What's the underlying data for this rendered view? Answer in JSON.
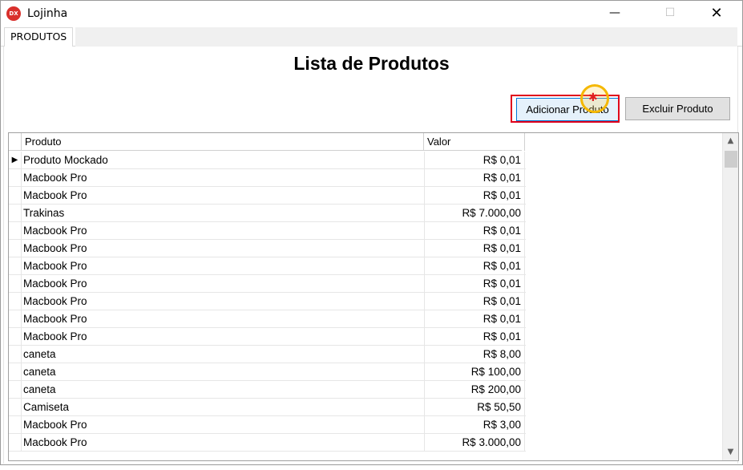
{
  "window": {
    "icon_text": "DX",
    "title": "Lojinha",
    "min_glyph": "—",
    "max_glyph": "☐",
    "close_glyph": "✕"
  },
  "tabs": [
    {
      "label": "PRODUTOS"
    }
  ],
  "main": {
    "heading": "Lista de Produtos",
    "add_button": "Adicionar Produto",
    "delete_button": "Excluir Produto"
  },
  "grid": {
    "columns": [
      "Produto",
      "Valor"
    ],
    "current_row_marker": "▶",
    "rows": [
      {
        "produto": "Produto Mockado",
        "valor": "R$ 0,01"
      },
      {
        "produto": "Macbook Pro",
        "valor": "R$ 0,01"
      },
      {
        "produto": "Macbook Pro",
        "valor": "R$ 0,01"
      },
      {
        "produto": "Trakinas",
        "valor": "R$ 7.000,00"
      },
      {
        "produto": "Macbook Pro",
        "valor": "R$ 0,01"
      },
      {
        "produto": "Macbook Pro",
        "valor": "R$ 0,01"
      },
      {
        "produto": "Macbook Pro",
        "valor": "R$ 0,01"
      },
      {
        "produto": "Macbook Pro",
        "valor": "R$ 0,01"
      },
      {
        "produto": "Macbook Pro",
        "valor": "R$ 0,01"
      },
      {
        "produto": "Macbook Pro",
        "valor": "R$ 0,01"
      },
      {
        "produto": "Macbook Pro",
        "valor": "R$ 0,01"
      },
      {
        "produto": "caneta",
        "valor": "R$ 8,00"
      },
      {
        "produto": "caneta",
        "valor": "R$ 100,00"
      },
      {
        "produto": "caneta",
        "valor": "R$ 200,00"
      },
      {
        "produto": "Camiseta",
        "valor": "R$ 50,50"
      },
      {
        "produto": "Macbook Pro",
        "valor": "R$ 3,00"
      },
      {
        "produto": "Macbook Pro",
        "valor": "R$ 3.000,00"
      }
    ]
  },
  "scrollbar": {
    "up_glyph": "▲",
    "down_glyph": "▼"
  }
}
